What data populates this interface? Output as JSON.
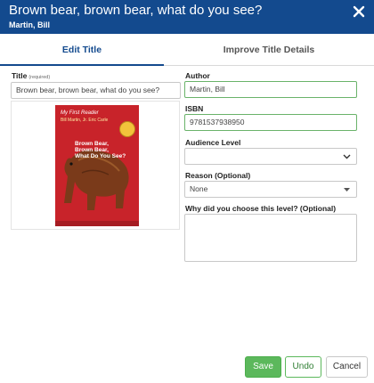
{
  "header": {
    "title": "Brown bear, brown bear, what do you see?",
    "subtitle": "Martin, Bill",
    "close_icon": "close-icon"
  },
  "tabs": [
    {
      "label": "Edit Title",
      "active": true
    },
    {
      "label": "Improve Title Details",
      "active": false
    }
  ],
  "form": {
    "title_label": "Title",
    "title_required": "(required)",
    "title_value": "Brown bear, brown bear, what do you see?",
    "author_label": "Author",
    "author_value": "Martin, Bill",
    "isbn_label": "ISBN",
    "isbn_value": "9781537938950",
    "audience_label": "Audience Level",
    "audience_value": "",
    "reason_label": "Reason (Optional)",
    "reason_value": "None",
    "why_label": "Why did you choose this level? (Optional)",
    "why_value": ""
  },
  "cover": {
    "series": "My First Reader",
    "authors": "Bill Martin, Jr. Eric Carle",
    "title_line1": "Brown Bear,",
    "title_line2": "Brown Bear,",
    "title_line3": "What Do You See?"
  },
  "buttons": {
    "save": "Save",
    "undo": "Undo",
    "cancel": "Cancel"
  },
  "colors": {
    "header_bg": "#134a8e",
    "accent": "#134a8e",
    "valid_border": "#6ab36a",
    "save_bg": "#5cb85c"
  }
}
